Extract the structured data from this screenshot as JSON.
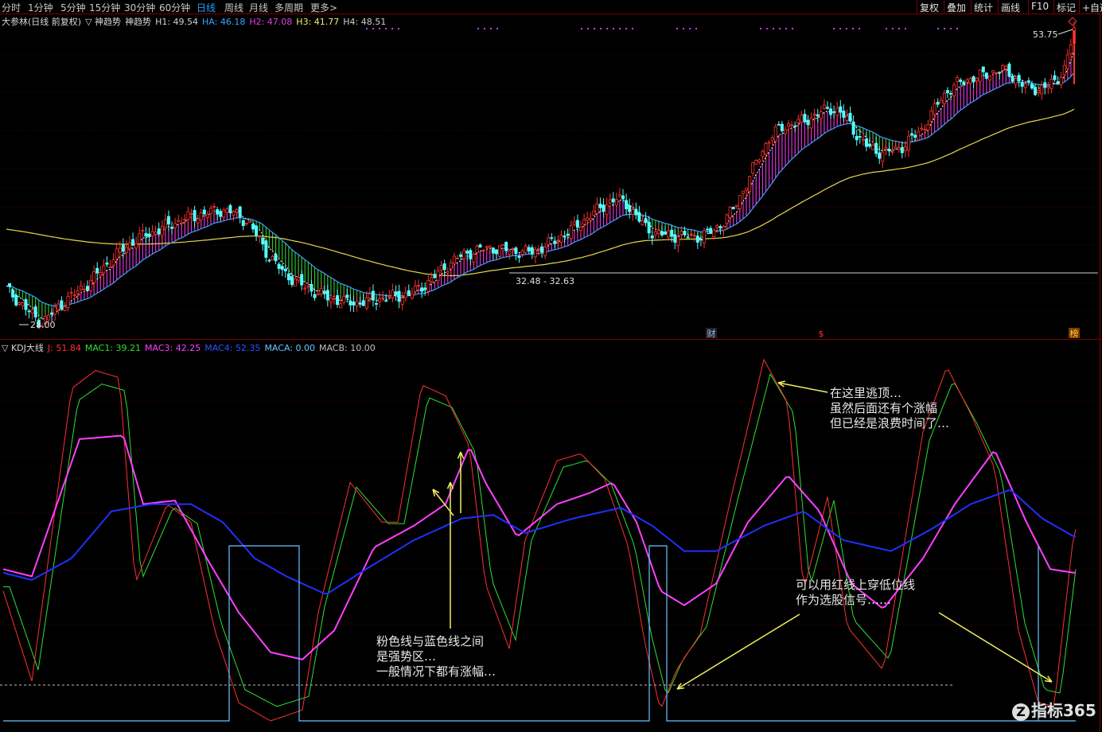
{
  "toolbar": {
    "periods": [
      "分时",
      "1分钟",
      "5分钟",
      "15分钟",
      "30分钟",
      "60分钟",
      "日线",
      "周线",
      "月线",
      "多周期",
      "更多>"
    ],
    "active_period": "日线",
    "tools": [
      "复权",
      "叠加",
      "统计",
      "画线",
      "F10",
      "标记",
      "+自选"
    ]
  },
  "main_panel": {
    "stock": "大参林(日线 前复权)",
    "indicator_toggle": "▽",
    "indicator": "神趋势",
    "indicator_repeat": "神趋势",
    "values": [
      {
        "label": "H1:",
        "value": "49.54",
        "color": "#d0d0d0"
      },
      {
        "label": "HA:",
        "value": "46.18",
        "color": "#3aa0ff"
      },
      {
        "label": "H2:",
        "value": "47.08",
        "color": "#e040e0"
      },
      {
        "label": "H3:",
        "value": "41.77",
        "color": "#f0f070"
      },
      {
        "label": "H4:",
        "value": "48.51",
        "color": "#d0d0d0"
      }
    ],
    "price_labels": {
      "high": "53.75",
      "low": "28.00",
      "range": "32.48 - 32.63"
    },
    "event_markers": [
      "财",
      "$",
      "榜"
    ]
  },
  "kdj_panel": {
    "toggle": "▽",
    "indicator": "KDJ大线",
    "values": [
      {
        "label": "J:",
        "value": "51.84",
        "color": "#ff3030"
      },
      {
        "label": "MAC1:",
        "value": "39.21",
        "color": "#30e030"
      },
      {
        "label": "MAC3:",
        "value": "42.25",
        "color": "#ff40ff"
      },
      {
        "label": "MAC4:",
        "value": "52.35",
        "color": "#3050ff"
      },
      {
        "label": "MACA:",
        "value": "0.00",
        "color": "#6cc4ff"
      },
      {
        "label": "MACB:",
        "value": "10.00",
        "color": "#c0c0c0"
      }
    ]
  },
  "annotations": {
    "escape_top": [
      "在这里逃顶…",
      "虽然后面还有个涨幅",
      "但已经是浪费时间了…"
    ],
    "strong_zone": [
      "粉色线与蓝色线之间",
      "是强势区…",
      "一般情况下都有涨幅…"
    ],
    "buy_signal": [
      "可以用红线上穿低位线",
      "作为选股信号……"
    ]
  },
  "watermark": {
    "logo": "Z",
    "text": "指标365"
  },
  "colors": {
    "up": "#ff3232",
    "down": "#54ffff",
    "pink": "#ff40ff",
    "blue": "#2030ff",
    "yellow_ma": "#e6d84a",
    "lightblue_ma": "#3aa0ff",
    "green_fill": "#40ff40"
  },
  "chart_data": {
    "type": "candlestick",
    "price_range_visible": [
      28.0,
      53.75
    ],
    "price_series": [
      31.0,
      30.2,
      29.4,
      28.6,
      28.0,
      28.8,
      29.6,
      30.2,
      30.8,
      31.4,
      32.2,
      33.0,
      33.8,
      34.5,
      35.1,
      35.6,
      35.9,
      36.2,
      36.6,
      36.9,
      37.2,
      37.4,
      37.6,
      37.8,
      37.9,
      37.8,
      37.4,
      36.8,
      35.6,
      34.2,
      33.2,
      32.4,
      31.8,
      31.3,
      30.9,
      30.5,
      30.2,
      30.0,
      29.8,
      29.8,
      29.9,
      30.1,
      30.2,
      30.3,
      30.4,
      30.6,
      31.0,
      31.6,
      32.3,
      33.0,
      33.6,
      34.0,
      34.3,
      34.5,
      34.6,
      34.5,
      34.4,
      34.3,
      34.2,
      34.4,
      34.8,
      35.2,
      35.7,
      36.2,
      36.8,
      37.4,
      38.0,
      38.6,
      38.9,
      38.6,
      37.6,
      36.6,
      36.0,
      35.8,
      35.7,
      35.7,
      35.6,
      35.6,
      35.8,
      36.2,
      37.0,
      38.0,
      39.5,
      41.2,
      42.8,
      44.2,
      45.0,
      45.4,
      45.6,
      45.8,
      46.2,
      46.6,
      46.9,
      46.5,
      45.5,
      44.3,
      43.5,
      43.1,
      43.0,
      43.2,
      43.6,
      44.3,
      45.0,
      46.2,
      47.6,
      48.5,
      49.0,
      49.4,
      49.6,
      49.8,
      50.1,
      50.3,
      49.8,
      49.1,
      48.7,
      48.6,
      48.8,
      49.3,
      50.5,
      53.75
    ],
    "ma_long_start": 37.5,
    "kdj": {
      "series_names": [
        "J",
        "MAC1",
        "MAC3",
        "MAC4",
        "MACA"
      ],
      "range": [
        0,
        100
      ],
      "MAC3_last": 42.25,
      "MAC4_last": 52.35
    }
  }
}
